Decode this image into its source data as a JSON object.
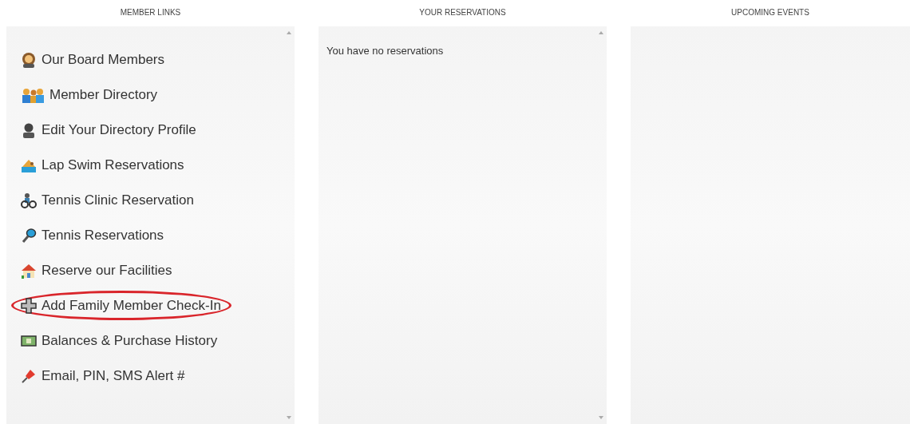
{
  "columns": [
    {
      "heading": "MEMBER LINKS",
      "kind": "links",
      "items": [
        {
          "label": "Our Board Members",
          "kind": "woman",
          "highlighted": false
        },
        {
          "label": "Member Directory",
          "kind": "family",
          "highlighted": false
        },
        {
          "label": "Edit Your Directory Profile",
          "kind": "person",
          "highlighted": false
        },
        {
          "label": "Lap Swim Reservations",
          "kind": "swimmer",
          "highlighted": false
        },
        {
          "label": "Tennis Clinic Reservation",
          "kind": "cyclist",
          "highlighted": false
        },
        {
          "label": "Tennis Reservations",
          "kind": "racket",
          "highlighted": false
        },
        {
          "label": "Reserve our Facilities",
          "kind": "house",
          "highlighted": false
        },
        {
          "label": "Add Family Member Check-In",
          "kind": "plus",
          "highlighted": true
        },
        {
          "label": "Balances & Purchase History",
          "kind": "money",
          "highlighted": false
        },
        {
          "label": "Email, PIN, SMS Alert #",
          "kind": "pin",
          "highlighted": false
        }
      ]
    },
    {
      "heading": "YOUR RESERVATIONS",
      "kind": "message",
      "message": "You have no reservations"
    },
    {
      "heading": "UPCOMING EVENTS",
      "kind": "empty"
    }
  ]
}
